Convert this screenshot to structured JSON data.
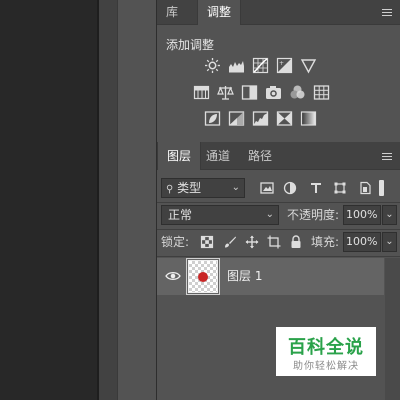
{
  "adjust_panel": {
    "tabs": [
      {
        "label": "库"
      },
      {
        "label": "调整"
      }
    ],
    "title": "添加调整"
  },
  "layers_panel": {
    "tabs": [
      {
        "label": "图层"
      },
      {
        "label": "通道"
      },
      {
        "label": "路径"
      }
    ],
    "filter": {
      "value": "类型"
    },
    "blend_mode": {
      "value": "正常"
    },
    "opacity": {
      "label": "不透明度:",
      "value": "100%"
    },
    "lock": {
      "label": "锁定:"
    },
    "fill": {
      "label": "填充:",
      "value": "100%"
    },
    "layers": [
      {
        "name": "图层 1",
        "visible": true,
        "thumb_color": "#c92626"
      }
    ]
  },
  "watermark": {
    "title": "百科全说",
    "subtitle": "助你轻松解决",
    "color": "#2aa24a"
  }
}
